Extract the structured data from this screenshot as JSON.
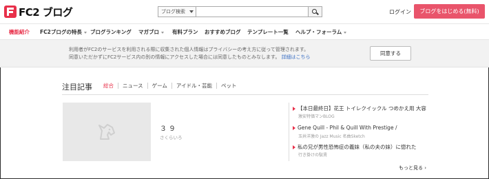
{
  "header": {
    "logo_text": "FC2 ブログ",
    "search_select": "ブログ検索",
    "search_placeholder": "",
    "login": "ログイン",
    "start_button": "ブログをはじめる(無料)"
  },
  "nav": {
    "items": [
      {
        "label": "機能紹介",
        "active": true
      },
      {
        "label": "FC2ブログの特長",
        "dropdown": true
      },
      {
        "label": "ブログランキング"
      },
      {
        "label": "マガブロ",
        "dropdown": true
      },
      {
        "label": "有料プラン"
      },
      {
        "label": "おすすめブログ"
      },
      {
        "label": "テンプレート一覧"
      },
      {
        "label": "ヘルプ・フォーラム",
        "dropdown": true
      }
    ]
  },
  "notice": {
    "line1": "利用者がFC2のサービスを利用される際に収集された個人情報はプライバシーの考え方に従って管理されます。",
    "line2": "同意いただかずにFC2サービス内の別の情報にアクセスした場合には同意したものとみなします。",
    "link": "詳細はこちら",
    "agree_button": "同意する"
  },
  "featured": {
    "title": "注目記事",
    "tabs": [
      "総合",
      "ニュース",
      "ゲーム",
      "アイドル・芸能",
      "ペット"
    ],
    "main_title": "３９",
    "main_author": "さくらいろ",
    "list": [
      {
        "title": "【本日最終日】花王 トイレクイックル つめかえ用 大容",
        "author": "激安特価マンBLOG"
      },
      {
        "title": "Gene Quill - Phil & Quill With Prestige /",
        "author": "玉井洋激の Jazz Music 名曲Sketch"
      },
      {
        "title": "私の兄が男性恐怖症の義妹（私の夫の妹）に惚れた",
        "author": "行き掛けの駄賃"
      }
    ],
    "more": "もっと見る ›"
  },
  "colors": {
    "accent": "#e8304a",
    "start_button": "#e9546b",
    "notice_bg": "#f2f2f2",
    "link": "#3a6fc4"
  }
}
